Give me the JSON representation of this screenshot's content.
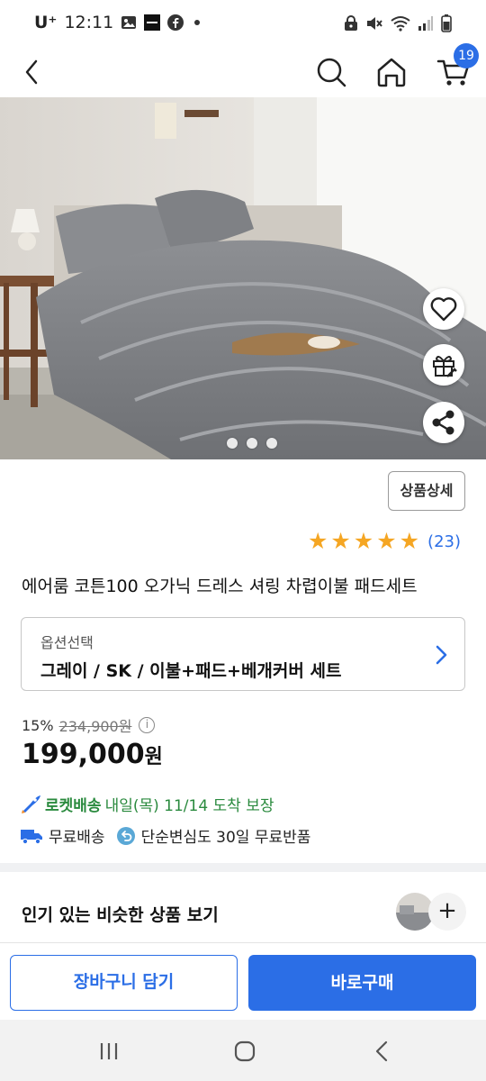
{
  "status_bar": {
    "carrier": "U⁺",
    "time": "12:11",
    "notification_icons": [
      "gallery-icon",
      "app-icon",
      "facebook-icon"
    ],
    "system_icons": [
      "lock-icon",
      "mute-icon",
      "wifi-icon",
      "signal-icon",
      "battery-icon"
    ]
  },
  "header": {
    "cart_count": "19"
  },
  "product": {
    "image_page_count": 3,
    "detail_button_label": "상품상세",
    "rating_stars": 5,
    "review_count": "(23)",
    "title": "에어룸 코튼100 오가닉 드레스 셔링 차렵이불 패드세트",
    "option": {
      "label": "옵션선택",
      "value": "그레이 / SK / 이불+패드+베개커버 세트"
    },
    "discount_rate": "15%",
    "original_price": "234,900원",
    "sale_price": "199,000",
    "sale_price_unit": "원"
  },
  "delivery": {
    "rocket_label": "로켓배송",
    "rocket_date": "내일(목) 11/14 도착 보장",
    "free_shipping": "무료배송",
    "free_return": "단순변심도 30일 무료반품"
  },
  "similar": {
    "title": "인기 있는 비슷한 상품 보기"
  },
  "actions": {
    "add_to_cart": "장바구니 담기",
    "buy_now": "바로구매"
  },
  "colors": {
    "accent": "#2b6ee6",
    "rocket_green": "#2a8a3e",
    "star": "#f5a623"
  }
}
